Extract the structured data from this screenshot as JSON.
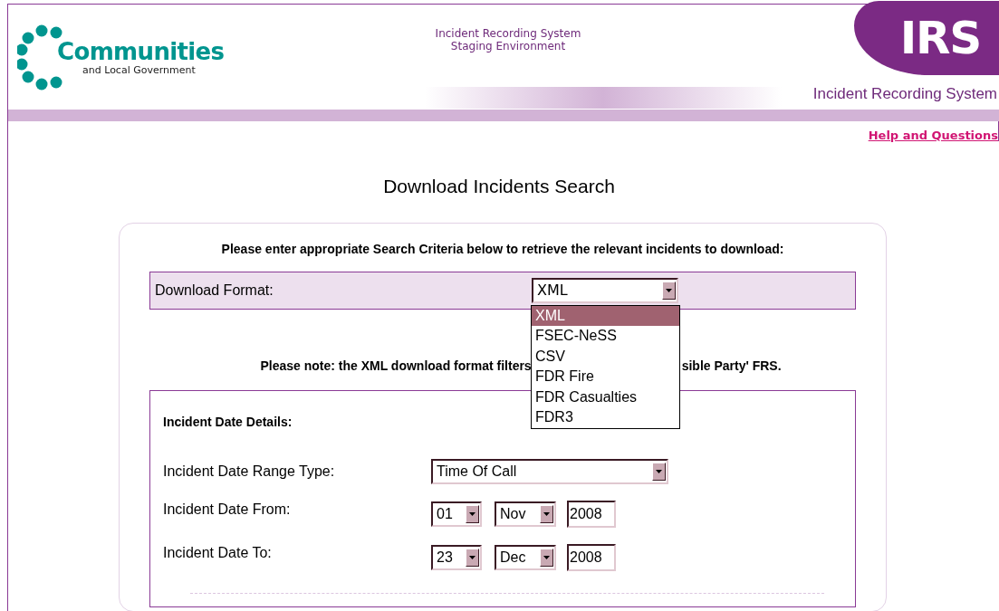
{
  "header": {
    "logo_main": "Communities",
    "logo_sub": "and Local Government",
    "environment": [
      "Incident Recording System",
      "Staging Environment"
    ],
    "irs_logo": "IRS",
    "system_name": "Incident Recording System"
  },
  "help_link": "Help and Questions",
  "page_title": "Download Incidents Search",
  "criteria_text": "Please enter appropriate Search Criteria below to retrieve the relevant incidents to download:",
  "download_format": {
    "label": "Download Format:",
    "value": "XML",
    "expanded": true,
    "options": [
      {
        "label": "XML",
        "selected": true
      },
      {
        "label": "FSEC-NeSS",
        "selected": false
      },
      {
        "label": "CSV",
        "selected": false
      },
      {
        "label": "FDR Fire",
        "selected": false
      },
      {
        "label": "FDR Casualties",
        "selected": false
      },
      {
        "label": "FDR3",
        "selected": false
      }
    ]
  },
  "note": {
    "before": "Please note: the XML download format filters",
    "after": "sible Party' FRS."
  },
  "date_details": {
    "heading": "Incident Date Details:",
    "range_type": {
      "label": "Incident Date Range Type:",
      "value": "Time Of Call"
    },
    "rows": [
      {
        "label": "Incident Date From:",
        "day": "01",
        "month": "Nov",
        "year": "2008"
      },
      {
        "label": "Incident Date To:",
        "day": "23",
        "month": "Dec",
        "year": "2008"
      }
    ]
  }
}
